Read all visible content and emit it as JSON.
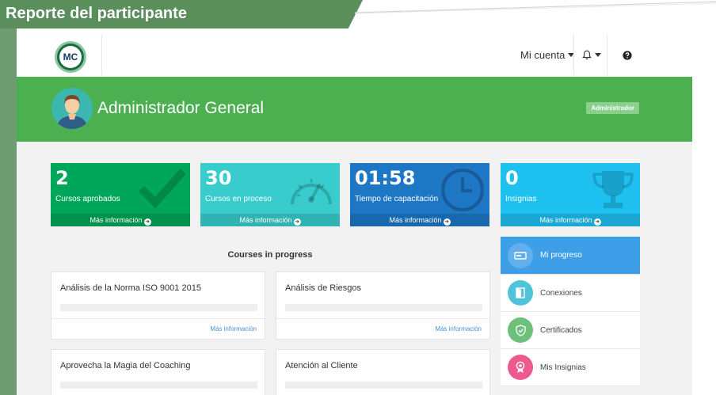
{
  "report": {
    "title": "Reporte del participante"
  },
  "logo": {
    "text": "MC"
  },
  "nav": {
    "account_label": "Mi cuenta",
    "bell_icon": "bell-icon",
    "help_icon": "question-circle-icon"
  },
  "header": {
    "user_name": "Administrador General",
    "role_badge": "Administrador"
  },
  "stats": [
    {
      "value": "2",
      "label": "Cursos aprobados",
      "more": "Más información",
      "color": "#00a65a",
      "icon": "check-icon"
    },
    {
      "value": "30",
      "label": "Cursos en proceso",
      "more": "Más información",
      "color": "#39cccc",
      "icon": "gauge-icon"
    },
    {
      "value": "01:58",
      "label": "Tiempo de capacitación",
      "more": "Más información",
      "color": "#1e77c4",
      "icon": "clock-icon"
    },
    {
      "value": "0",
      "label": "Insignias",
      "more": "Más información",
      "color": "#1ec0f0",
      "icon": "trophy-icon"
    }
  ],
  "courses": {
    "section_title": "Courses in progress",
    "items": [
      {
        "title": "Análisis de la Norma ISO 9001 2015",
        "more": "Más información"
      },
      {
        "title": "Análisis de Riesgos",
        "more": "Más información"
      },
      {
        "title": "Aprovecha la Magia del Coaching",
        "more": ""
      },
      {
        "title": "Atención al Cliente",
        "more": ""
      }
    ]
  },
  "side_menu": [
    {
      "label": "Mi progreso",
      "icon": "card-icon",
      "color": "#3f9ee8",
      "active": true
    },
    {
      "label": "Conexiones",
      "icon": "door-icon",
      "color": "#4fc3d8",
      "active": false
    },
    {
      "label": "Certificados",
      "icon": "shield-check-icon",
      "color": "#6cc07a",
      "active": false
    },
    {
      "label": "Mis Insignias",
      "icon": "award-icon",
      "color": "#ec5a8e",
      "active": false
    }
  ]
}
